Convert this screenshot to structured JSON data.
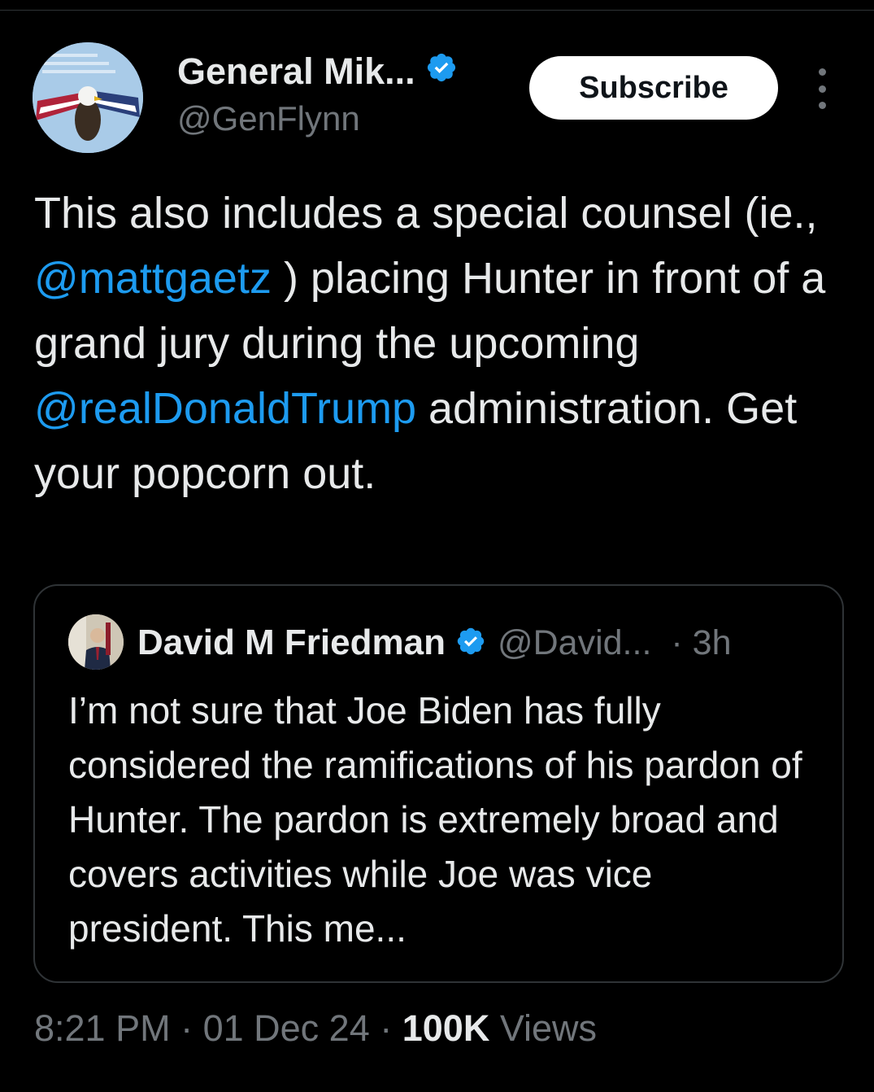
{
  "post": {
    "author": {
      "name": "General Mik...",
      "handle": "@GenFlynn",
      "verified": true
    },
    "subscribe_label": "Subscribe",
    "body": {
      "part1": "This also includes a special counsel (ie., ",
      "mention1": "@mattgaetz",
      "part2": " ) placing Hunter in front of a grand jury during the upcoming ",
      "mention2": "@realDonaldTrump",
      "part3": " administration. Get your popcorn out."
    },
    "meta": {
      "time": "8:21 PM",
      "sep1": " · ",
      "date": "01 Dec 24",
      "sep2": " · ",
      "views_count": "100K",
      "views_label": " Views"
    }
  },
  "quote": {
    "author_name": "David M Friedman",
    "handle": "@David...",
    "time": "· 3h",
    "text": "I’m not sure that Joe Biden has fully considered the ramifications of his pardon of Hunter. The pardon is extremely broad and covers activities while Joe was vice president. This me..."
  },
  "colors": {
    "background": "#000000",
    "text": "#e7e9ea",
    "secondary": "#71767b",
    "link": "#1d9bf0",
    "verified": "#1d9bf0",
    "border": "#2f3336"
  },
  "icons": {
    "verified": "verified-badge-icon",
    "more": "more-vertical-icon"
  }
}
